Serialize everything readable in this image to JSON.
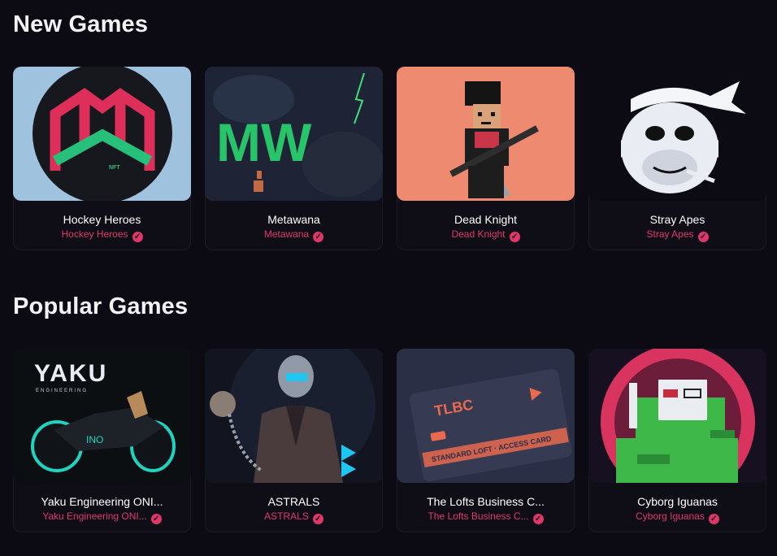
{
  "sections": [
    {
      "title": "New Games",
      "cards": [
        {
          "title": "Hockey Heroes",
          "creator": "Hockey Heroes",
          "image": "hockey-heroes-logo",
          "bg": "#9fc3df"
        },
        {
          "title": "Metawana",
          "creator": "Metawana",
          "image": "metawana-logo",
          "bg": "#1e2436"
        },
        {
          "title": "Dead Knight",
          "creator": "Dead Knight",
          "image": "dead-knight-pixel-art",
          "bg": "#ee8a70"
        },
        {
          "title": "Stray Apes",
          "creator": "Stray Apes",
          "image": "stray-apes-logo",
          "bg": "#0c0b14"
        }
      ]
    },
    {
      "title": "Popular Games",
      "cards": [
        {
          "title": "Yaku Engineering ONI...",
          "creator": "Yaku Engineering ONI...",
          "image": "yaku-motorcycle",
          "bg": "#0c0f12"
        },
        {
          "title": "ASTRALS",
          "creator": "ASTRALS",
          "image": "astrals-character",
          "bg": "#121520"
        },
        {
          "title": "The Lofts Business C...",
          "creator": "The Lofts Business C...",
          "image": "tlbc-access-card",
          "bg": "#2b2f45"
        },
        {
          "title": "Cyborg Iguanas",
          "creator": "Cyborg Iguanas",
          "image": "cyborg-iguana-pixel-art",
          "bg": "#171020"
        }
      ]
    }
  ],
  "art_text": {
    "mw": "MW",
    "nft": "NFT",
    "yaku": "YAKU",
    "yaku_sub": "ENGINEERING",
    "tlbc": "TLBC",
    "tlbc_card": "STANDARD LOFT · ACCESS CARD"
  },
  "colors": {
    "accent": "#e0376b",
    "background": "#0c0b14"
  },
  "verified_icon": "check-badge-icon"
}
